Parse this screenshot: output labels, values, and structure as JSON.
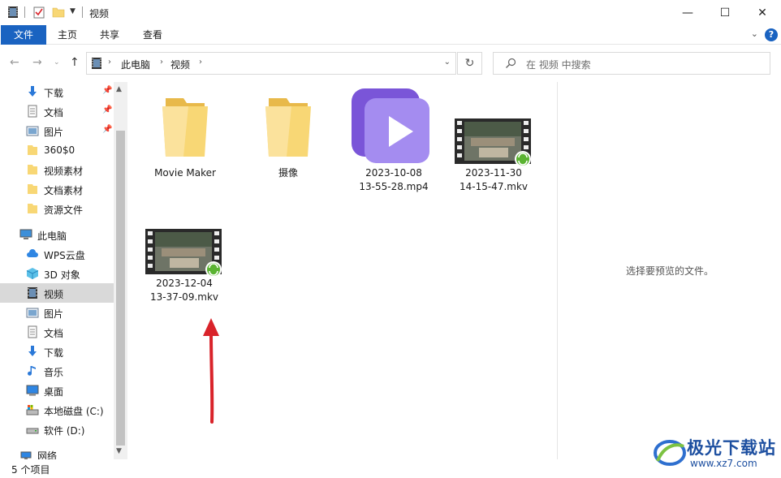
{
  "window": {
    "title": "视频",
    "minimize": "—",
    "maximize": "☐",
    "close": "✕"
  },
  "ribbon": {
    "tabs": [
      "文件",
      "主页",
      "共享",
      "查看"
    ],
    "help": "?"
  },
  "address": {
    "crumbs": [
      "此电脑",
      "视频"
    ]
  },
  "search": {
    "placeholder": "在 视频 中搜索"
  },
  "sidebar": {
    "quick_access": [
      {
        "label": "下载",
        "icon": "download-icon",
        "pinned": true
      },
      {
        "label": "文档",
        "icon": "document-icon",
        "pinned": true
      },
      {
        "label": "图片",
        "icon": "picture-icon",
        "pinned": true
      },
      {
        "label": "360$0",
        "icon": "folder-icon",
        "pinned": false
      },
      {
        "label": "视频素材",
        "icon": "folder-icon",
        "pinned": false
      },
      {
        "label": "文档素材",
        "icon": "folder-icon",
        "pinned": false
      },
      {
        "label": "资源文件",
        "icon": "folder-icon",
        "pinned": false
      }
    ],
    "this_pc": "此电脑",
    "pc_items": [
      {
        "label": "WPS云盘",
        "icon": "cloud-icon"
      },
      {
        "label": "3D 对象",
        "icon": "cube-icon"
      },
      {
        "label": "视频",
        "icon": "video-icon",
        "active": true
      },
      {
        "label": "图片",
        "icon": "picture-icon"
      },
      {
        "label": "文档",
        "icon": "document-icon"
      },
      {
        "label": "下载",
        "icon": "download-icon"
      },
      {
        "label": "音乐",
        "icon": "music-icon"
      },
      {
        "label": "桌面",
        "icon": "desktop-icon"
      },
      {
        "label": "本地磁盘 (C:)",
        "icon": "drive-c-icon"
      },
      {
        "label": "软件 (D:)",
        "icon": "drive-d-icon"
      }
    ],
    "network": "网络"
  },
  "files": [
    {
      "name": "Movie Maker",
      "type": "folder"
    },
    {
      "name": "摄像",
      "type": "folder"
    },
    {
      "name": "2023-10-08\n13-55-28.mp4",
      "line1": "2023-10-08",
      "line2": "13-55-28.mp4",
      "type": "mp4"
    },
    {
      "name": "2023-11-30\n14-15-47.mkv",
      "line1": "2023-11-30",
      "line2": "14-15-47.mkv",
      "type": "mkv"
    },
    {
      "name": "2023-12-04\n13-37-09.mkv",
      "line1": "2023-12-04",
      "line2": "13-37-09.mkv",
      "type": "mkv"
    }
  ],
  "preview": {
    "message": "选择要预览的文件。"
  },
  "status": {
    "count": "5 个项目"
  },
  "watermark": {
    "text": "极光下载站",
    "url": "www.xz7.com"
  },
  "colors": {
    "accent": "#1a63c1",
    "folder": "#f8d775",
    "annotation_arrow": "#d9232a"
  }
}
